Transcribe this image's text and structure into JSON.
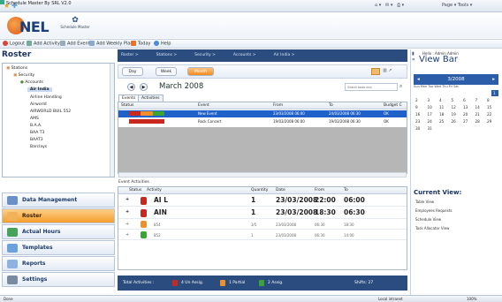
{
  "browser": {
    "tab_title": "Schedule Master By SRL V2.0",
    "right_tools": "Page ▾  Tools ▾"
  },
  "logo": {
    "text": "NEL",
    "sub": "Schedule Master"
  },
  "toolbar": {
    "logout": "Logout",
    "add_activity": "Add Activity",
    "add_event": "Add Event",
    "add_weekly_plan": "Add Weekly Plan",
    "today": "Today",
    "help": "Help",
    "hello": "Hello : Admin Admin"
  },
  "roster_title": "Roster",
  "breadcrumb": [
    "Roster >",
    "Stations >",
    "Security >",
    "Accounts >",
    "Air India >"
  ],
  "tree": {
    "items": [
      {
        "label": "Stations",
        "indent": 0
      },
      {
        "label": "Security",
        "indent": 1
      },
      {
        "label": "Accounts",
        "indent": 2
      },
      {
        "label": "Air India",
        "indent": 3,
        "selected": true
      },
      {
        "label": "Airline Handling",
        "indent": 3
      },
      {
        "label": "Airworld",
        "indent": 3
      },
      {
        "label": "AIRWORLD BUIL 552",
        "indent": 3
      },
      {
        "label": "AMS",
        "indent": 3
      },
      {
        "label": "B.A.A.",
        "indent": 3
      },
      {
        "label": "BAA T3",
        "indent": 3
      },
      {
        "label": "BAAT3",
        "indent": 3
      },
      {
        "label": "Barclays",
        "indent": 3
      }
    ]
  },
  "nav": {
    "data_management": "Data Management",
    "roster": "Roster",
    "actual_hours": "Actual Hours",
    "templates": "Templates",
    "reports": "Reports",
    "settings": "Settings"
  },
  "view_tabs": {
    "day": "Day",
    "week": "Week",
    "month": "Month",
    "active": "Month"
  },
  "month_title": "March 2008",
  "search_placeholder": "Search tasks now",
  "sub_tabs": {
    "events": "Events",
    "activities": "Activities"
  },
  "events_table": {
    "headers": [
      "Status",
      "Event",
      "From",
      "To",
      "Budget C"
    ],
    "rows": [
      {
        "event": "New Event",
        "from": "23/03/2008 06:00",
        "to": "24/03/2008 06:30",
        "budget": "OK",
        "selected": true
      },
      {
        "event": "Rock Concert",
        "from": "19/03/2008 06:00",
        "to": "19/03/2008 06:30",
        "budget": "OK",
        "selected": false
      }
    ]
  },
  "event_activities_label": "Event Activities",
  "activities_table": {
    "headers": [
      "Status",
      "Activity",
      "Quantity",
      "Date",
      "From",
      "To"
    ],
    "rows": [
      {
        "status_color": "#c8281e",
        "activity": "AI L",
        "quantity": "1",
        "date": "23/03/2008",
        "from": "22:00",
        "to": "06:00",
        "size": "big"
      },
      {
        "status_color": "#c8281e",
        "activity": "AIN",
        "quantity": "1",
        "date": "23/03/2008",
        "from": "18:30",
        "to": "06:30",
        "size": "big"
      },
      {
        "status_color": "#f0902a",
        "activity": "854",
        "quantity": "3/5",
        "date": "23/03/2008",
        "from": "06:30",
        "to": "18:30",
        "size": "small"
      },
      {
        "status_color": "#3aa536",
        "activity": "852",
        "quantity": "1",
        "date": "23/03/2008",
        "from": "06:30",
        "to": "14:00",
        "size": "small"
      }
    ]
  },
  "totals": {
    "label": "Total Activities :",
    "unassigned": "4 Un Assig.",
    "partial": "1 Partial",
    "assigned": "2 Assig.",
    "shifts": "Shifts: 27",
    "colors": {
      "unassigned": "#c8281e",
      "partial": "#f0902a",
      "assigned": "#3aa536"
    }
  },
  "view_bar": {
    "title": "View Bar",
    "calendar_month": "3/2008",
    "day_header": "Sun Mon Tue Wed Thu Fri Sat",
    "weeks": [
      [
        "",
        "",
        "",
        "",
        "",
        "",
        "1"
      ],
      [
        "2",
        "3",
        "4",
        "5",
        "6",
        "7",
        "8"
      ],
      [
        "9",
        "10",
        "11",
        "12",
        "13",
        "14",
        "15"
      ],
      [
        "16",
        "17",
        "18",
        "19",
        "20",
        "21",
        "22"
      ],
      [
        "23",
        "24",
        "25",
        "26",
        "27",
        "28",
        "29"
      ],
      [
        "30",
        "31",
        "",
        "",
        "",
        "",
        ""
      ]
    ],
    "current_view_title": "Current View:",
    "links": [
      "Table View",
      "Employees Requests",
      "Schedule View",
      "Task Allocator View"
    ]
  },
  "status_bar": {
    "left": "Done",
    "zone": "Local intranet",
    "zoom": "100%"
  }
}
